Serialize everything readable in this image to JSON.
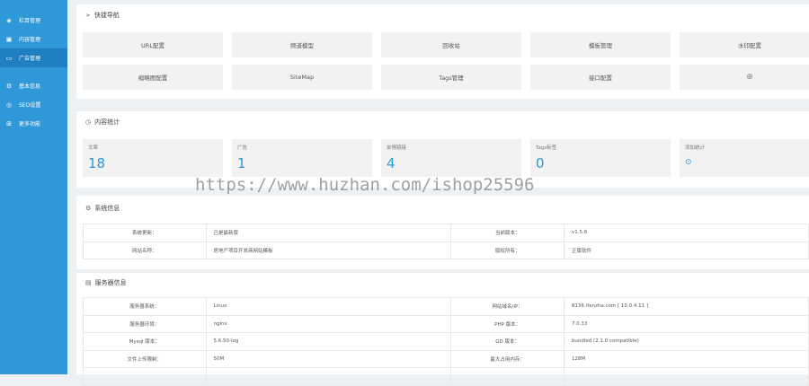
{
  "sidebar": {
    "items": [
      {
        "label": "栏目管理",
        "icon": "layers-icon"
      },
      {
        "label": "内容管理",
        "icon": "document-icon"
      },
      {
        "label": "广告管理",
        "icon": "ad-icon"
      },
      {
        "label": "基本信息",
        "icon": "gear-icon"
      },
      {
        "label": "SEO设置",
        "icon": "seo-icon"
      },
      {
        "label": "更多功能",
        "icon": "grid-icon"
      }
    ]
  },
  "quick_nav": {
    "title": "快捷导航",
    "items": [
      "URL配置",
      "频道模型",
      "回收站",
      "模板管理",
      "水印配置",
      "缩略图配置",
      "SiteMap",
      "Tags管理",
      "接口配置",
      "⊕"
    ]
  },
  "stats": {
    "title": "内容统计",
    "cards": [
      {
        "label": "文章",
        "value": "18"
      },
      {
        "label": "广告",
        "value": "1"
      },
      {
        "label": "友情链接",
        "value": "4"
      },
      {
        "label": "Tags标签",
        "value": "0"
      }
    ],
    "add_label": "添加统计",
    "add_symbol": "⊙"
  },
  "watermark": "https://www.huzhan.com/ishop25596",
  "system": {
    "title": "系统信息",
    "rows": [
      [
        "系统更新：",
        "已是最新版",
        "当前版本：",
        "v1.5.6"
      ],
      [
        "网站名称：",
        "房地产项目开发商网站模板",
        "版权所有：",
        "正版软件"
      ]
    ]
  },
  "server": {
    "title": "服务器信息",
    "rows": [
      [
        "服务器系统：",
        "Linux",
        "网站域名/IP：",
        "8136.ifanzha.com [ 10.0.4.11 ]"
      ],
      [
        "服务器环境：",
        "nginx",
        "PHP 版本：",
        "7.0.33"
      ],
      [
        "Mysql 版本：",
        "5.6.50-log",
        "GD 版本：",
        "bundled (2.1.0 compatible)"
      ],
      [
        "文件上传限制：",
        "50M",
        "最大占用内存：",
        "128M"
      ],
      [
        "",
        "",
        "",
        ""
      ]
    ]
  }
}
